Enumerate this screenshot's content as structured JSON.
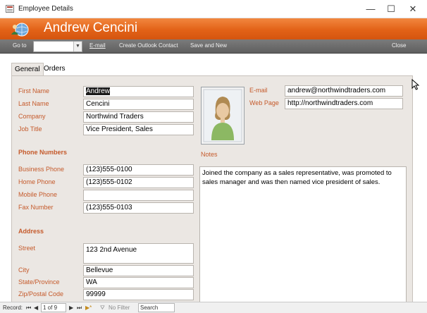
{
  "window": {
    "title": "Employee Details",
    "minimize_glyph": "—",
    "maximize_glyph": "☐",
    "close_glyph": "✕"
  },
  "header": {
    "logo_icon": "globe-people-icon",
    "record_name": "Andrew Cencini"
  },
  "toolbar": {
    "goto_label": "Go to",
    "goto_value": "",
    "email_label": "E-mail",
    "outlook_label": "Create Outlook Contact",
    "save_new_label": "Save and New",
    "close_label": "Close"
  },
  "tabs": [
    {
      "label": "General",
      "active": true
    },
    {
      "label": "Orders",
      "active": false
    }
  ],
  "general": {
    "first_name_label": "First Name",
    "first_name": "Andrew",
    "last_name_label": "Last Name",
    "last_name": "Cencini",
    "company_label": "Company",
    "company": "Northwind Traders",
    "job_title_label": "Job Title",
    "job_title": "Vice President, Sales",
    "phone_section": "Phone Numbers",
    "business_phone_label": "Business Phone",
    "business_phone": "(123)555-0100",
    "home_phone_label": "Home Phone",
    "home_phone": "(123)555-0102",
    "mobile_phone_label": "Mobile Phone",
    "mobile_phone": "",
    "fax_label": "Fax Number",
    "fax": "(123)555-0103",
    "address_section": "Address",
    "street_label": "Street",
    "street": "123 2nd Avenue",
    "city_label": "City",
    "city": "Bellevue",
    "state_label": "State/Province",
    "state": "WA",
    "zip_label": "Zip/Postal Code",
    "zip": "99999",
    "email_label": "E-mail",
    "email": "andrew@northwindtraders.com",
    "webpage_label": "Web Page",
    "webpage": "http://northwindtraders.com",
    "notes_label": "Notes",
    "notes": "Joined the company as a sales representative, was promoted to sales manager and was then named vice president of sales.",
    "photo_icon": "person-silhouette-icon"
  },
  "navigation": {
    "record_label": "Record:",
    "first_glyph": "⏮",
    "prev_glyph": "◀",
    "position": "1 of 9",
    "next_glyph": "▶",
    "last_glyph": "⏭",
    "new_glyph": "▶*",
    "filter_label": "No Filter",
    "search_label": "Search"
  },
  "colors": {
    "header_orange": "#e26217",
    "label_orange": "#c55a2b",
    "panel_bg": "#ebe7e3",
    "toolbar_gray": "#6a6a6a"
  }
}
